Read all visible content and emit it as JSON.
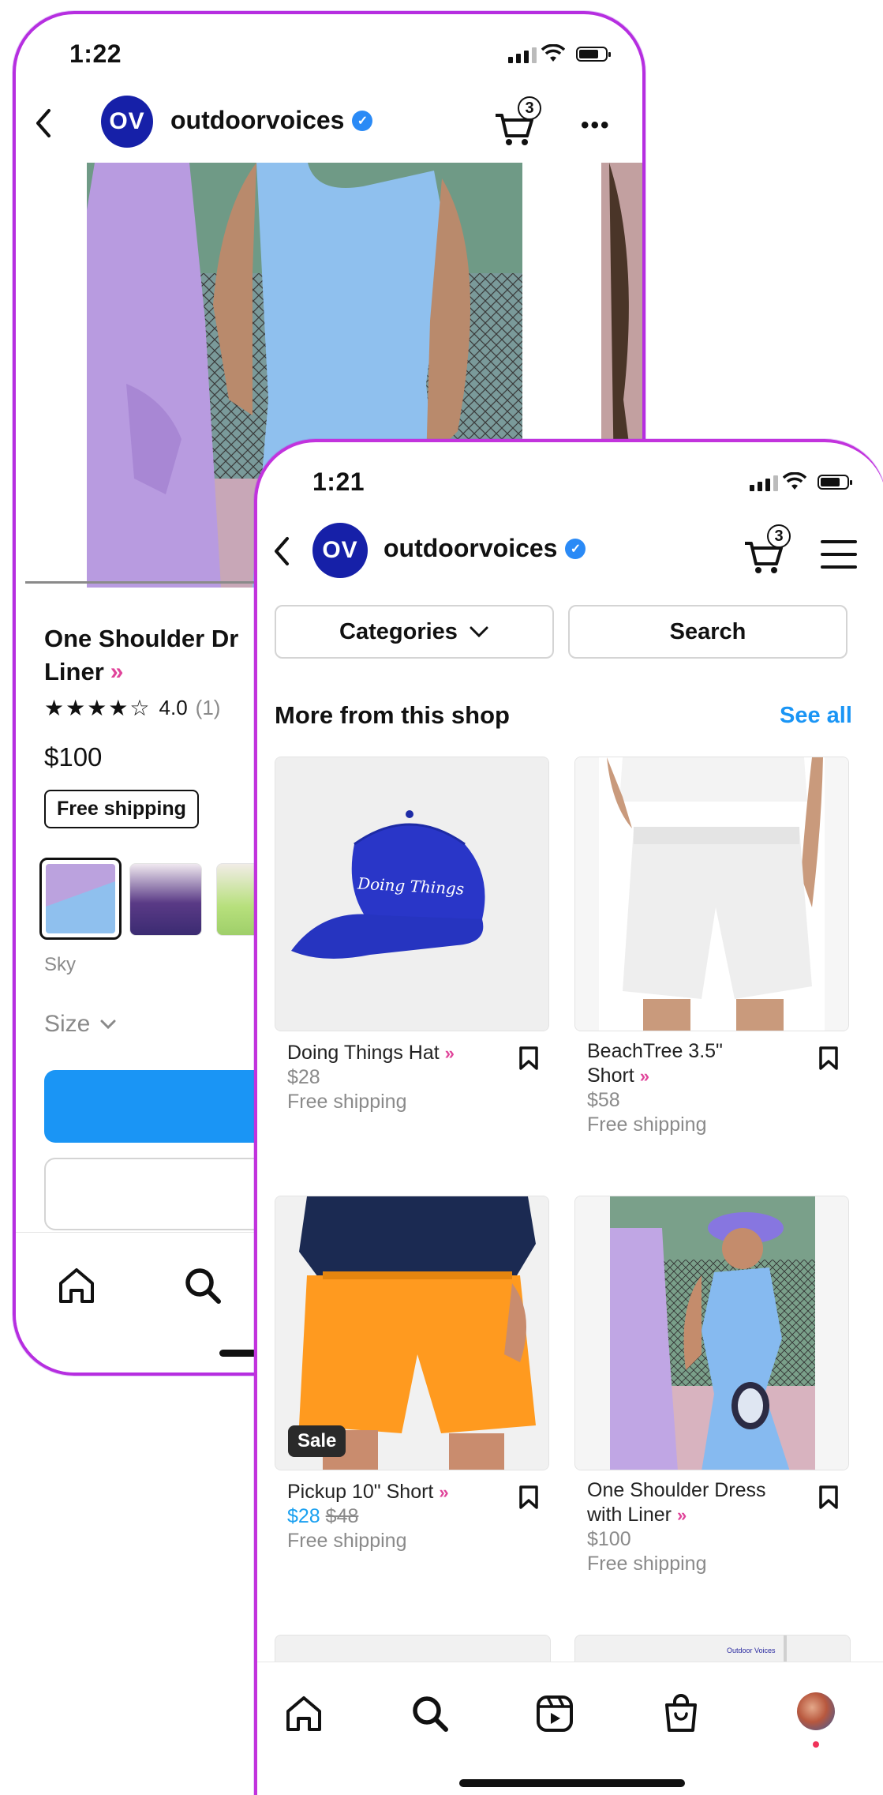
{
  "back_screen": {
    "status_time": "1:22",
    "shop": {
      "avatar": "OV",
      "name": "outdoorvoices",
      "cart_count": "3"
    },
    "product": {
      "title_line1": "One Shoulder Dr",
      "title_line2": "Liner",
      "stars": "★★★★☆",
      "rating": "4.0",
      "rating_count": "(1)",
      "price": "$100",
      "shipping_badge": "Free shipping",
      "color_label": "Sky",
      "size_label": "Size"
    }
  },
  "front_screen": {
    "status_time": "1:21",
    "shop": {
      "avatar": "OV",
      "name": "outdoorvoices",
      "cart_count": "3"
    },
    "filters": {
      "categories": "Categories",
      "search": "Search"
    },
    "section": {
      "title": "More from this shop",
      "see_all": "See all"
    },
    "products": [
      {
        "name": "Doing Things Hat",
        "price": "$28",
        "shipping": "Free shipping",
        "hat_text": "Doing Things"
      },
      {
        "name_line1": "BeachTree 3.5\"",
        "name_line2": "Short",
        "price": "$58",
        "shipping": "Free shipping"
      },
      {
        "name": "Pickup 10\" Short",
        "sale_price": "$28",
        "original_price": "$48",
        "shipping": "Free shipping",
        "badge": "Sale"
      },
      {
        "name_line1": "One Shoulder Dress",
        "name_line2": "with Liner",
        "price": "$100",
        "shipping": "Free shipping"
      }
    ],
    "peek_label": "Outdoor Voices"
  },
  "colors": {
    "accent_blue": "#1a95f5",
    "brand_navy": "#1620a8",
    "frame_purple": "#c02ad8",
    "sale_blue": "#1aa0f0"
  },
  "icons": [
    "back-icon",
    "verified-icon",
    "cart-icon",
    "more-icon",
    "menu-icon",
    "chevron-down-icon",
    "bookmark-icon",
    "home-icon",
    "search-icon",
    "reels-icon",
    "shop-icon",
    "profile-avatar"
  ]
}
